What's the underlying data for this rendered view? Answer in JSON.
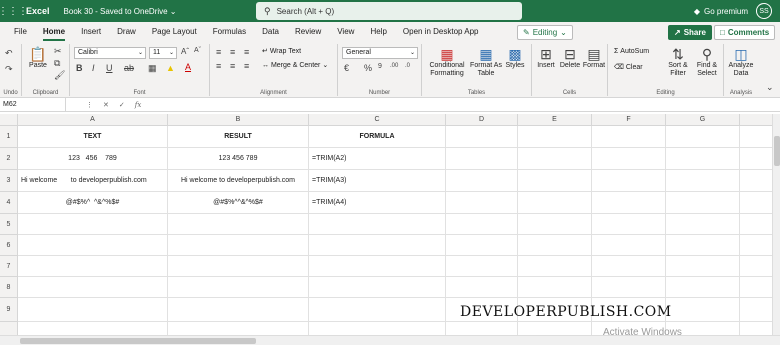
{
  "topbar": {
    "app_name": "Excel",
    "doc_title": "Book 30  -  Saved to OneDrive ⌄",
    "search_placeholder": "Search (Alt + Q)",
    "premium_label": "Go premium",
    "avatar_initials": "SS"
  },
  "tabs": [
    "File",
    "Home",
    "Insert",
    "Draw",
    "Page Layout",
    "Formulas",
    "Data",
    "Review",
    "View",
    "Help",
    "Open in Desktop App"
  ],
  "active_tab": "Home",
  "editing_label": "Editing",
  "share_label": "Share",
  "comments_label": "Comments",
  "ribbon": {
    "undo_group": "Undo",
    "paste": "Paste",
    "clipboard_group": "Clipboard",
    "font_name": "Calibri",
    "font_size": "11",
    "font_group": "Font",
    "wrap_text": "Wrap Text",
    "merge_center": "Merge & Center",
    "alignment_group": "Alignment",
    "number_format": "General",
    "number_group": "Number",
    "conditional_formatting": "Conditional Formatting",
    "format_as_table": "Format As Table",
    "styles": "Styles",
    "tables_group": "Tables",
    "insert": "Insert",
    "delete": "Delete",
    "format": "Format",
    "cells_group": "Cells",
    "autosum": "AutoSum",
    "clear": "Clear",
    "sort_filter": "Sort & Filter",
    "find_select": "Find & Select",
    "editing_group": "Editing",
    "analyze_data": "Analyze Data",
    "analysis_group": "Analysis"
  },
  "formula_bar": {
    "name_box": "M62",
    "fx": "fx"
  },
  "columns": [
    "A",
    "B",
    "C",
    "D",
    "E",
    "F",
    "G"
  ],
  "rows": [
    "1",
    "2",
    "3",
    "4",
    "5",
    "6",
    "7",
    "8",
    "9"
  ],
  "cells": {
    "A1": "TEXT",
    "B1": "RESULT",
    "C1": "FORMULA",
    "A2": "123   456    789",
    "B2": "123 456 789",
    "C2": "=TRIM(A2)",
    "A3": "Hi welcome       to developerpublish.com",
    "B3": "Hi welcome to developerpublish.com",
    "C3": "=TRIM(A3)",
    "A4": "@#$%^  ^&^%$#",
    "B4": "@#$%^^&^%$#",
    "C4": "=TRIM(A4)"
  },
  "watermark": "DEVELOPERPUBLISH.COM",
  "activate_windows": "Activate Windows"
}
